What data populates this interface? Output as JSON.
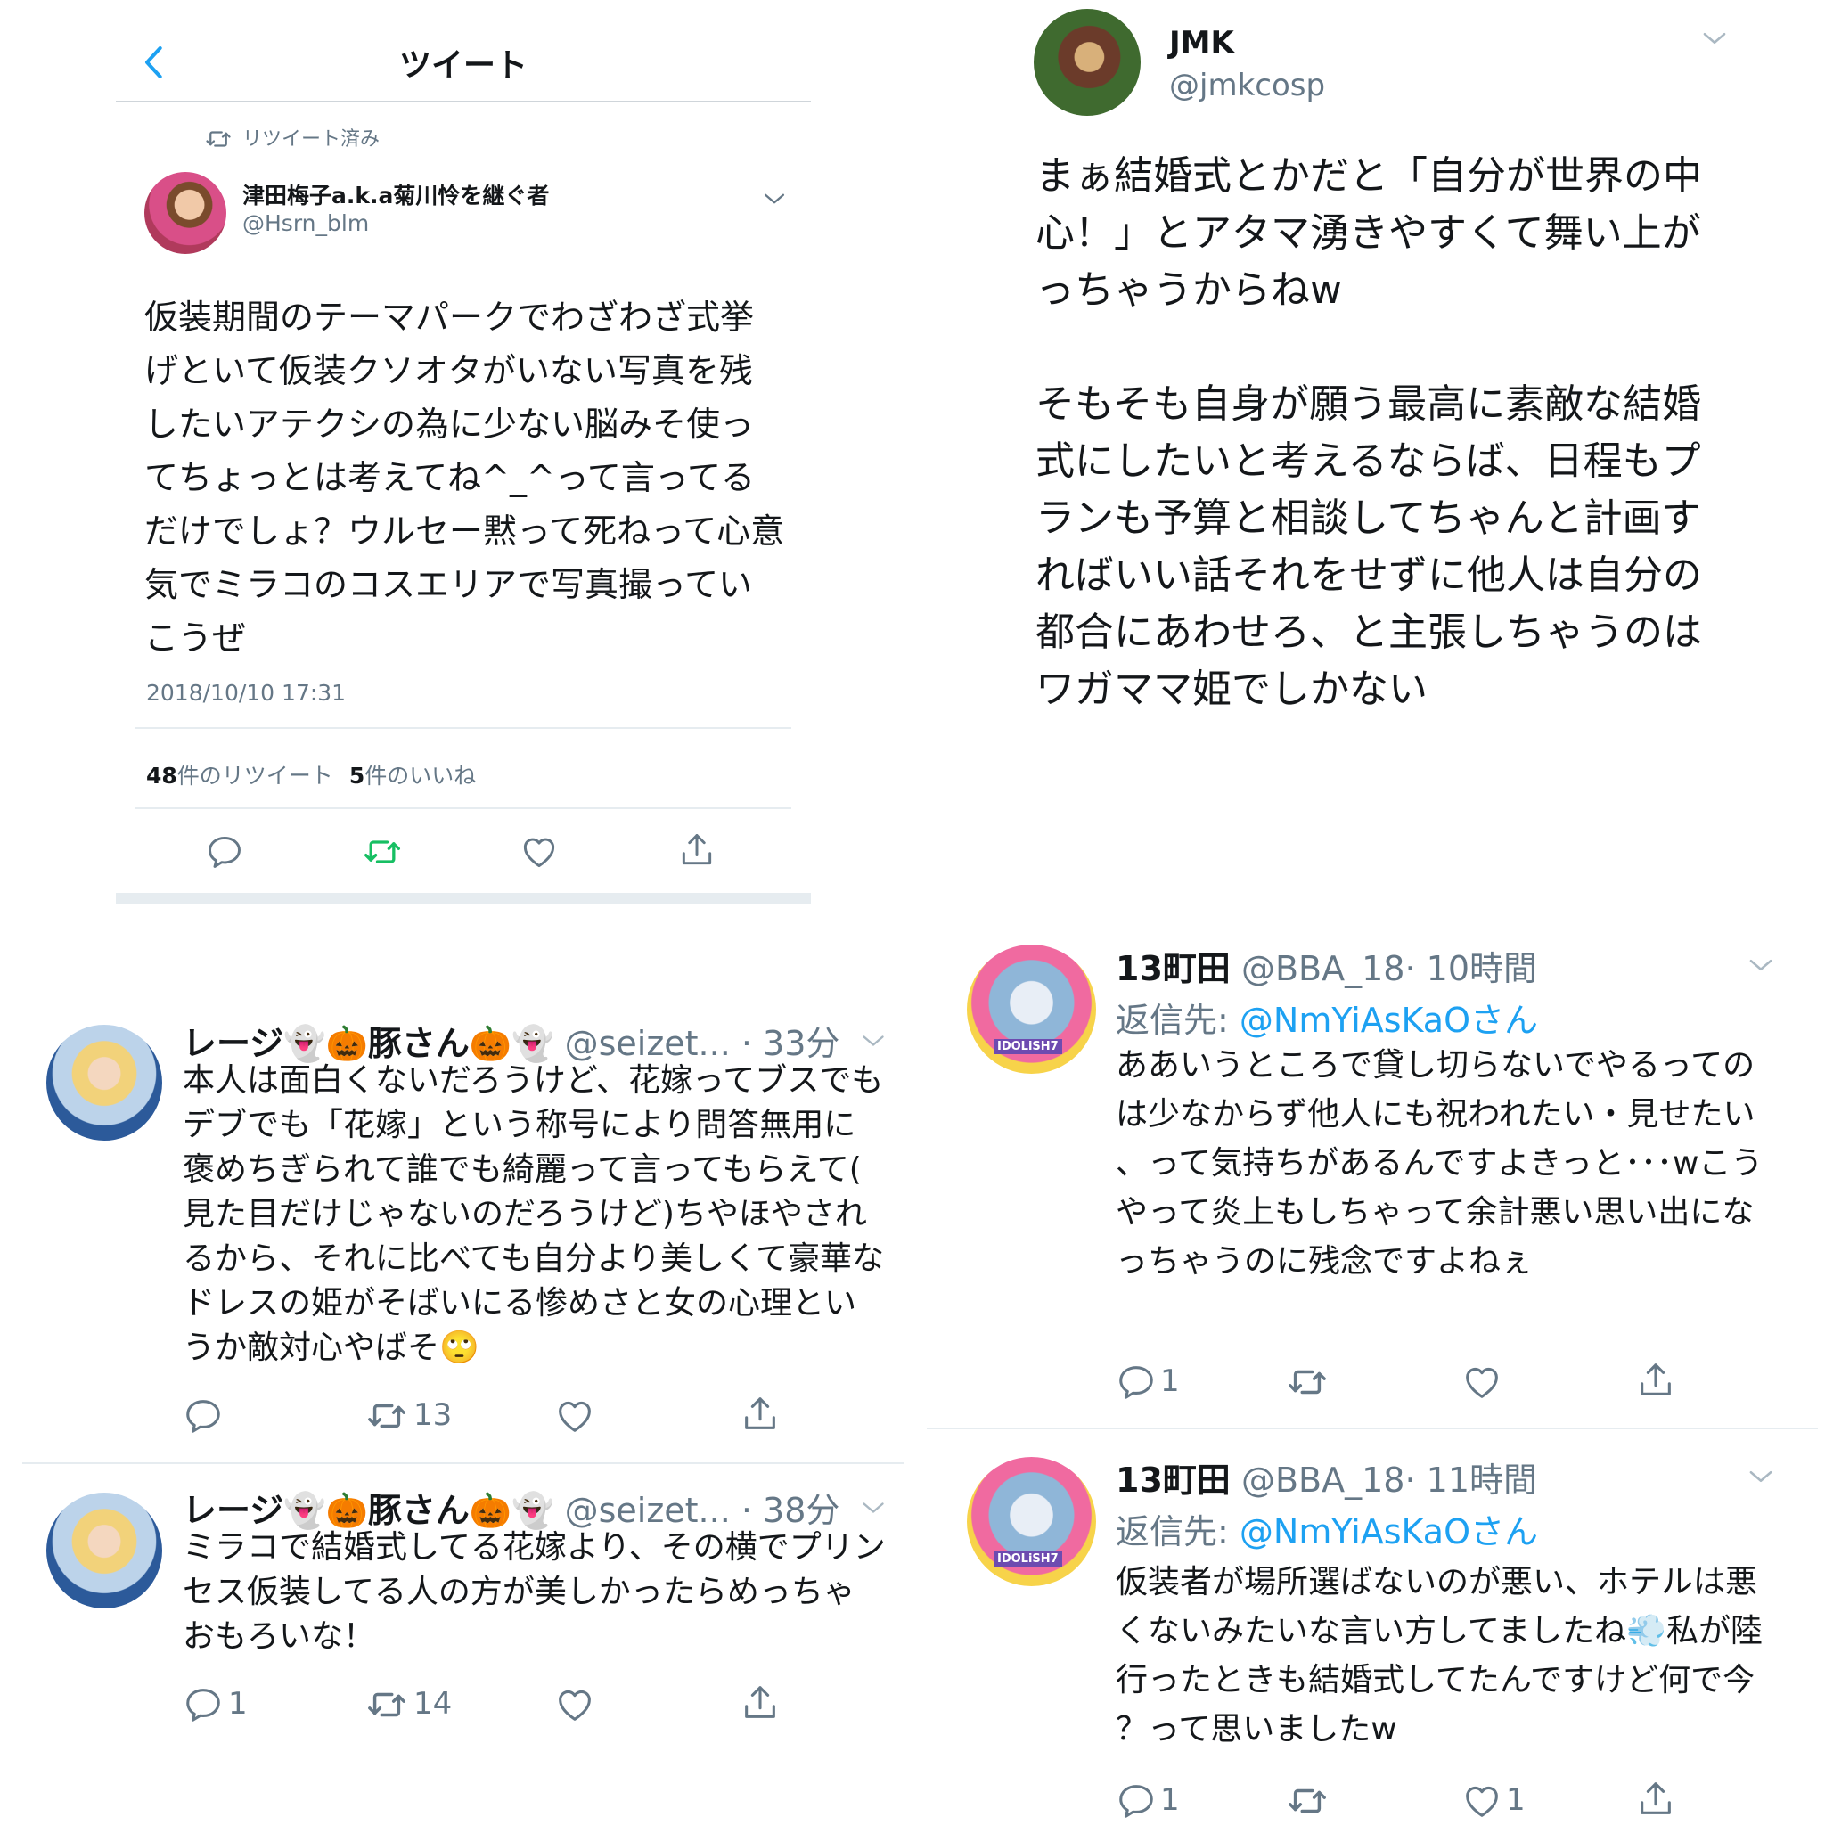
{
  "panel1": {
    "nav_title": "ツイート",
    "retweeted_label": "リツイート済み",
    "name": "津田梅子a.k.a菊川怜を継ぐ者",
    "handle": "@Hsrn_blm",
    "text": "仮装期間のテーマパークでわざわざ式挙げといて仮装クソオタがいない写真を残したいアテクシの為に少ない脳みそ使ってちょっとは考えてね^_^って言ってるだけでしょ？ウルセー黙って死ねって心意気でミラコのコスエリアで写真撮っていこうぜ",
    "timestamp": "2018/10/10 17:31",
    "retweet_count": "48",
    "retweet_label": "件のリツイート",
    "like_count": "5",
    "like_label": "件のいいね",
    "colors": {
      "retweet_active": "#17bf63",
      "accent": "#1da1f2"
    }
  },
  "panel2": {
    "name": "JMK",
    "handle": "@jmkcosp",
    "paragraphs": [
      "まぁ結婚式とかだと「自分が世界の中心！」とアタマ湧きやすくて舞い上がっちゃうからねw",
      "そもそも自身が願う最高に素敵な結婚式にしたいと考えるならば、日程もプランも予算と相談してちゃんと計画すればいい話それをせずに他人は自分の都合にあわせろ、と主張しちゃうのはワガママ姫でしかない"
    ]
  },
  "replies_left": [
    {
      "name": "レージ👻🎃豚さん🎃👻",
      "handle": "@seizet...",
      "time": "· 33分",
      "text": "本人は面白くないだろうけど、花嫁ってブスでもデブでも「花嫁」という称号により問答無用に褒めちぎられて誰でも綺麗って言ってもらえて(見た目だけじゃないのだろうけど)ちやほやされるから、それに比べても自分より美しくて豪華なドレスの姫がそばいにる惨めさと女の心理というか敵対心やばそ🙄",
      "reply_count": "",
      "retweet_count": "13",
      "like_count": ""
    },
    {
      "name": "レージ👻🎃豚さん🎃👻",
      "handle": "@seizet...",
      "time": "· 38分",
      "text": "ミラコで結婚式してる花嫁より、その横でプリンセス仮装してる人の方が美しかったらめっちゃおもろいな！",
      "reply_count": "1",
      "retweet_count": "14",
      "like_count": ""
    }
  ],
  "replies_right": [
    {
      "name": "13町田",
      "handle": "@BBA_18",
      "time": "· 10時間",
      "reply_to_label": "返信先:",
      "reply_to_handle": "@NmYiAsKaOさん",
      "text": "ああいうところで貸し切らないでやるってのは少なからず他人にも祝われたい・見せたい、って気持ちがあるんですよきっと･･･wこうやって炎上もしちゃって余計悪い思い出になっちゃうのに残念ですよねぇ",
      "reply_count": "1",
      "retweet_count": "",
      "like_count": "",
      "avatar_badge": "IDOLiSH7"
    },
    {
      "name": "13町田",
      "handle": "@BBA_18",
      "time": "· 11時間",
      "reply_to_label": "返信先:",
      "reply_to_handle": "@NmYiAsKaOさん",
      "text": "仮装者が場所選ばないのが悪い、ホテルは悪くないみたいな言い方してましたね💨私が陸行ったときも結婚式してたんですけど何で今？って思いましたw",
      "reply_count": "1",
      "retweet_count": "",
      "like_count": "1",
      "avatar_badge": "IDOLiSH7"
    }
  ],
  "icons": [
    "back-chevron-icon",
    "retweet-icon",
    "chevron-down-icon",
    "reply-icon",
    "heart-icon",
    "share-icon"
  ]
}
